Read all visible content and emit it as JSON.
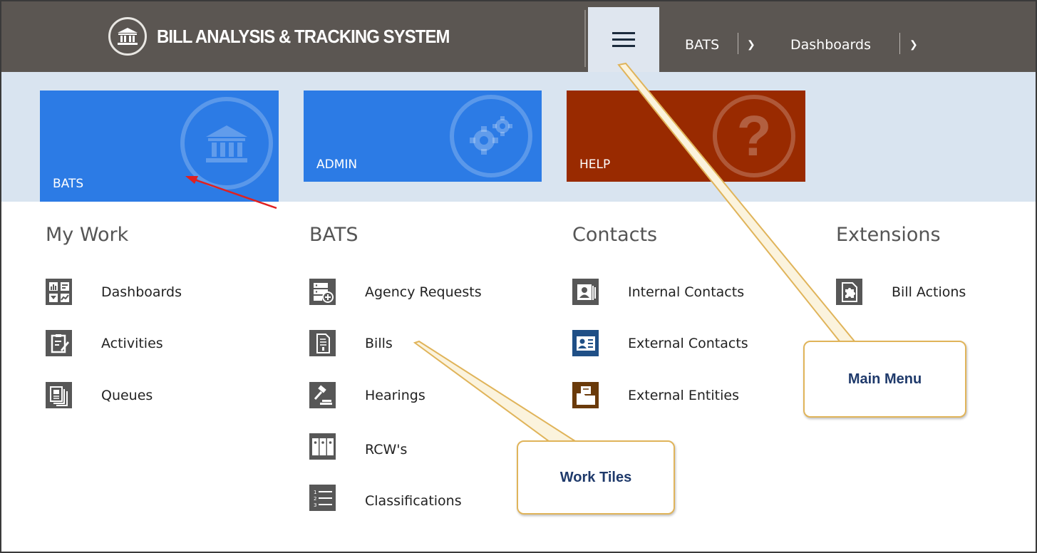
{
  "header": {
    "app_title": "BILL ANALYSIS & TRACKING SYSTEM",
    "logo_icon": "courthouse-icon",
    "menu_icon": "hamburger-icon",
    "nav": [
      {
        "label": "BATS",
        "chevron": "chevron-down-icon"
      },
      {
        "label": "Dashboards",
        "chevron": "chevron-down-icon"
      }
    ]
  },
  "tiles": [
    {
      "label": "BATS",
      "color": "#2c7be5",
      "icon": "courthouse-icon"
    },
    {
      "label": "ADMIN",
      "color": "#2c7be5",
      "icon": "gears-icon"
    },
    {
      "label": "HELP",
      "color": "#992a00",
      "icon": "question-icon"
    }
  ],
  "sections": {
    "my_work": {
      "heading": "My Work",
      "items": [
        {
          "label": "Dashboards",
          "icon": "dashboard-grid-icon"
        },
        {
          "label": "Activities",
          "icon": "clipboard-edit-icon"
        },
        {
          "label": "Queues",
          "icon": "stacked-documents-icon"
        }
      ]
    },
    "bats": {
      "heading": "BATS",
      "items": [
        {
          "label": "Agency Requests",
          "icon": "server-add-icon"
        },
        {
          "label": "Bills",
          "icon": "document-icon"
        },
        {
          "label": "Hearings",
          "icon": "gavel-icon"
        },
        {
          "label": "RCW's",
          "icon": "binders-icon"
        },
        {
          "label": "Classifications",
          "icon": "numbered-list-icon"
        }
      ]
    },
    "contacts": {
      "heading": "Contacts",
      "items": [
        {
          "label": "Internal Contacts",
          "icon": "contact-card-icon",
          "color": "#575757"
        },
        {
          "label": "External Contacts",
          "icon": "contact-card-blue-icon",
          "color": "#1f4f86"
        },
        {
          "label": "External Entities",
          "icon": "folder-entity-icon",
          "color": "#6a3a0a"
        }
      ]
    },
    "extensions": {
      "heading": "Extensions",
      "items": [
        {
          "label": "Bill Actions",
          "icon": "puzzle-doc-icon"
        }
      ]
    }
  },
  "callouts": {
    "main_menu": "Main Menu",
    "work_tiles": "Work Tiles"
  },
  "colors": {
    "topbar": "#5b5652",
    "tilebar": "#d9e4f0",
    "callout_border": "#e0b45a",
    "callout_text": "#1f3a6b",
    "arrow_red": "#e02020"
  }
}
